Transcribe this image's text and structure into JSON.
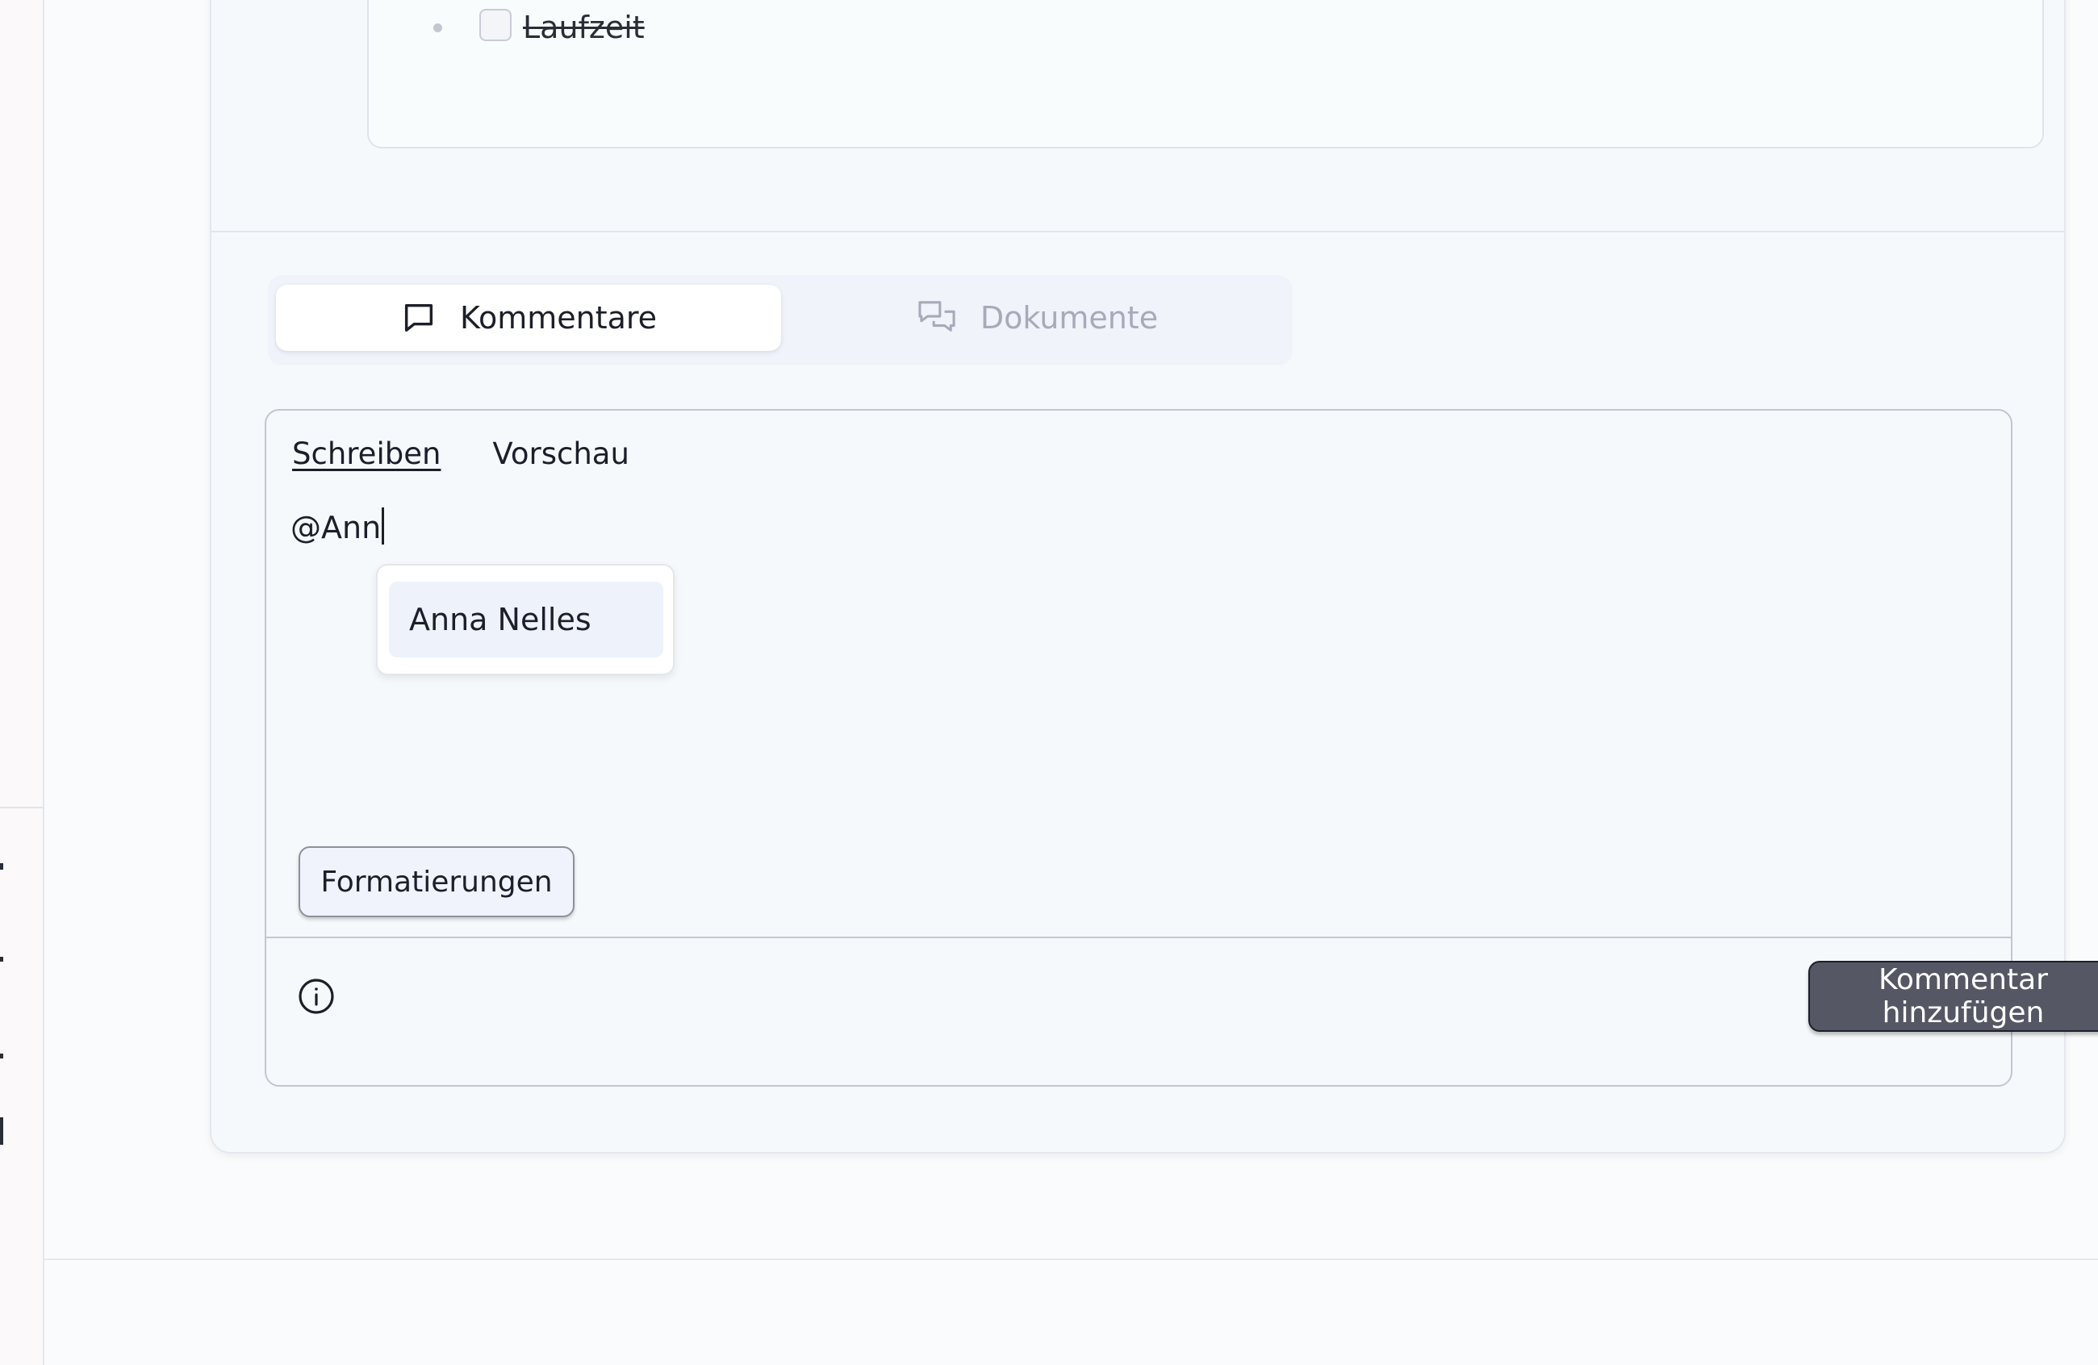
{
  "checklist": {
    "items": [
      {
        "label": "Laufzeit",
        "checked": false,
        "struck_through": true
      }
    ]
  },
  "tabs": [
    {
      "label": "Kommentare",
      "icon": "chat-bubble-icon",
      "active": true
    },
    {
      "label": "Dokumente",
      "icon": "chat-bubbles-icon",
      "active": false
    }
  ],
  "editor": {
    "mode_tabs": {
      "write": "Schreiben",
      "preview": "Vorschau"
    },
    "text": "@Ann",
    "mention_suggestions": [
      "Anna Nelles"
    ],
    "format_button": "Formatierungen",
    "info_icon": "info-circle-icon",
    "submit_button": "Kommentar hinzufügen"
  },
  "colors": {
    "submit_bg": "#555764",
    "active_tab_bg": "#ffffff",
    "inactive_tab_text": "#a7abb8",
    "mention_highlight": "#eef2fb"
  }
}
